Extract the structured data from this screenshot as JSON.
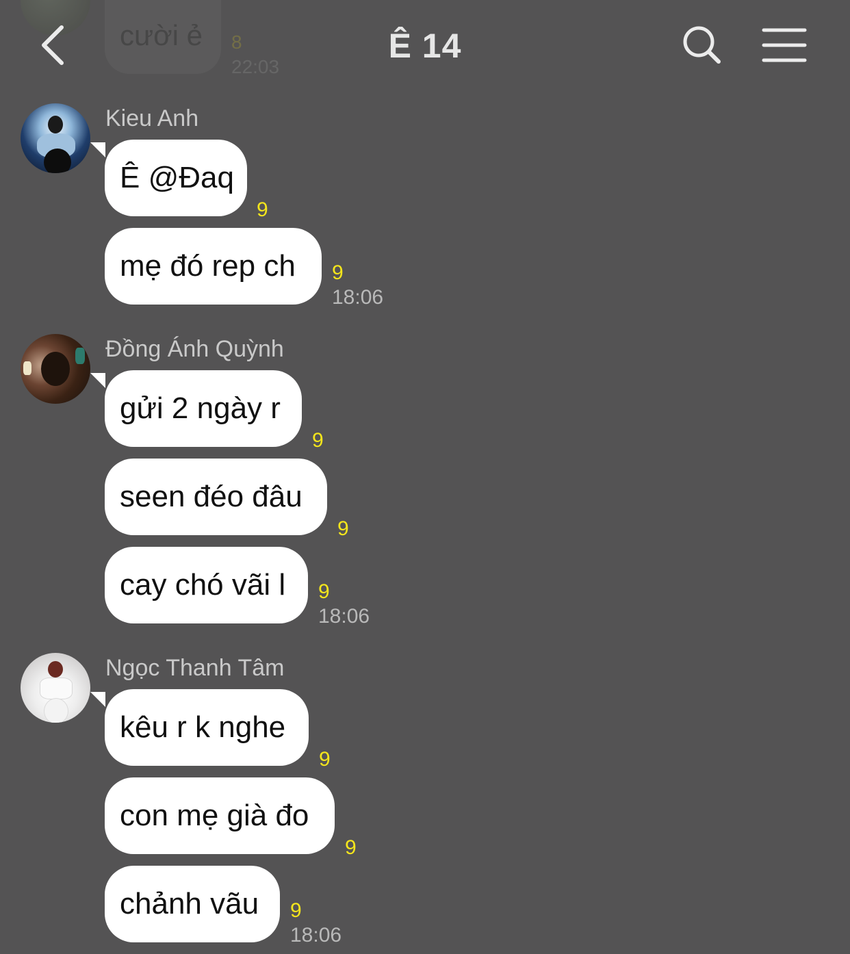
{
  "header": {
    "title": "Ê 14"
  },
  "previous_message": {
    "text": "cười ẻ",
    "count": "8",
    "time": "22:03"
  },
  "groups": [
    {
      "sender": "Kieu Anh",
      "messages": [
        {
          "text": "Ê @Đaq",
          "count": "9"
        },
        {
          "text": "mẹ đó rep ch",
          "count": "9",
          "time": "18:06"
        }
      ]
    },
    {
      "sender": "Đồng Ánh Quỳnh",
      "messages": [
        {
          "text": "gửi 2 ngày r",
          "count": "9"
        },
        {
          "text": "seen đéo đâu",
          "count": "9"
        },
        {
          "text": "cay chó vãi l",
          "count": "9",
          "time": "18:06"
        }
      ]
    },
    {
      "sender": "Ngọc Thanh Tâm",
      "messages": [
        {
          "text": "kêu r k nghe",
          "count": "9"
        },
        {
          "text": "con mẹ già đo",
          "count": "9"
        },
        {
          "text": "chảnh vãu",
          "count": "9",
          "time": "18:06"
        }
      ]
    }
  ]
}
